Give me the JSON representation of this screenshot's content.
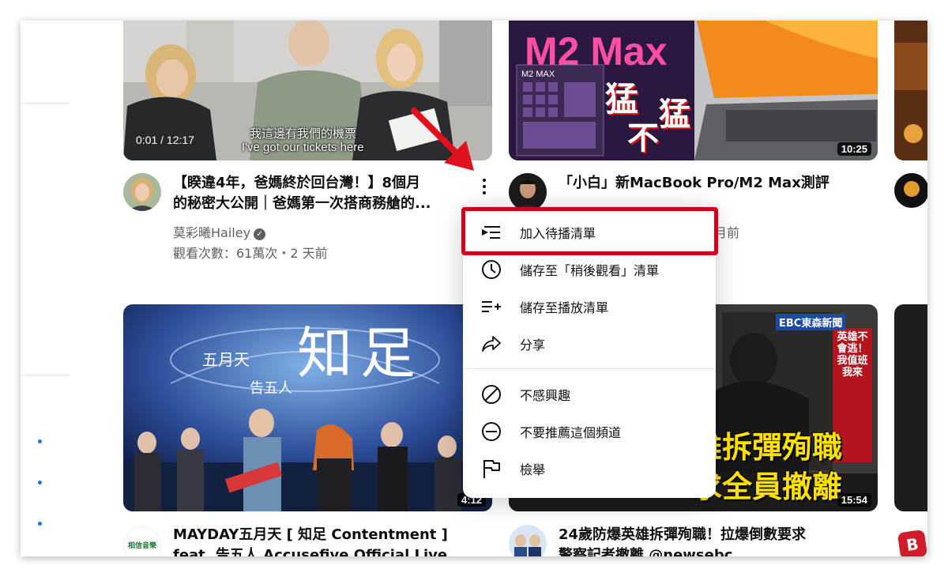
{
  "videos": [
    {
      "title_line1": "【睽違4年，爸媽終於回台灣！】8個月",
      "title_line2": "的秘密大公開｜爸媽第一次搭商務艙的...",
      "channel": "莫彩曦Hailey",
      "stats": "觀看次數：61萬次・2 天前",
      "progress_time": "0:01 / 12:17",
      "subtitle_zh": "我這邊有我們的機票",
      "subtitle_en": "I've got our tickets here"
    },
    {
      "title_line1": "「小白」新MacBook Pro/M2 Max測評",
      "title_line2": "",
      "channel": "",
      "stats_tail": "月前",
      "duration": "10:25",
      "thumb_text_big": "M2 Max",
      "thumb_text_small": "M2 MAX",
      "thumb_text_cn1": "猛",
      "thumb_text_cn2": "不",
      "thumb_text_cn3": "猛"
    },
    {
      "title_line1": "MAYDAY五月天 [ 知足 Contentment ]",
      "title_line2": "feat. 告五人 Accusefive Official Live",
      "duration": "4:12",
      "thumb_text_big": "知足",
      "thumb_text_artist": "五月天",
      "thumb_text_feat": "告五人",
      "channel_logo": "相信音樂"
    },
    {
      "title_line1": "24歲防爆英雄拆彈殉職！拉爆倒數要求",
      "title_line2": "警察記者撤離 @newsebc",
      "duration": "15:54",
      "thumb_logo": "EBC東森新聞",
      "thumb_text_big1": "雄拆彈殉職",
      "thumb_text_big2": "求全員撤離",
      "thumb_side": "英雄不會逃！我值班我來"
    }
  ],
  "menu": {
    "items": [
      {
        "label": "加入待播清單",
        "icon": "add-to-queue-icon"
      },
      {
        "label": "儲存至「稍後觀看」清單",
        "icon": "clock-icon"
      },
      {
        "label": "儲存至播放清單",
        "icon": "playlist-add-icon"
      },
      {
        "label": "分享",
        "icon": "share-icon"
      },
      {
        "label": "不感興趣",
        "icon": "not-interested-icon"
      },
      {
        "label": "不要推薦這個頻道",
        "icon": "remove-channel-icon"
      },
      {
        "label": "檢舉",
        "icon": "flag-icon"
      }
    ]
  },
  "colors": {
    "highlight": "#d0021b",
    "arrow": "#e0101e",
    "link_dot": "#1a73e8"
  }
}
